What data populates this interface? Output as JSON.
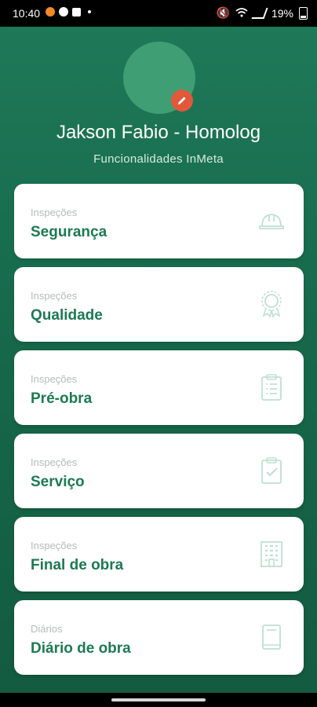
{
  "status": {
    "time": "10:40",
    "battery": "19%"
  },
  "profile": {
    "name": "Jakson Fabio - Homolog",
    "subtitle": "Funcionalidades InMeta"
  },
  "colors": {
    "accent": "#1c7a52",
    "badge": "#e2583a",
    "icon": "#bfe0d2"
  },
  "cards": [
    {
      "category": "Inspeções",
      "title": "Segurança",
      "icon": "hard-hat-icon"
    },
    {
      "category": "Inspeções",
      "title": "Qualidade",
      "icon": "award-ribbon-icon"
    },
    {
      "category": "Inspeções",
      "title": "Pré-obra",
      "icon": "clipboard-list-icon"
    },
    {
      "category": "Inspeções",
      "title": "Serviço",
      "icon": "clipboard-check-icon"
    },
    {
      "category": "Inspeções",
      "title": "Final de obra",
      "icon": "building-icon"
    },
    {
      "category": "Diários",
      "title": "Diário de obra",
      "icon": "book-icon"
    }
  ]
}
